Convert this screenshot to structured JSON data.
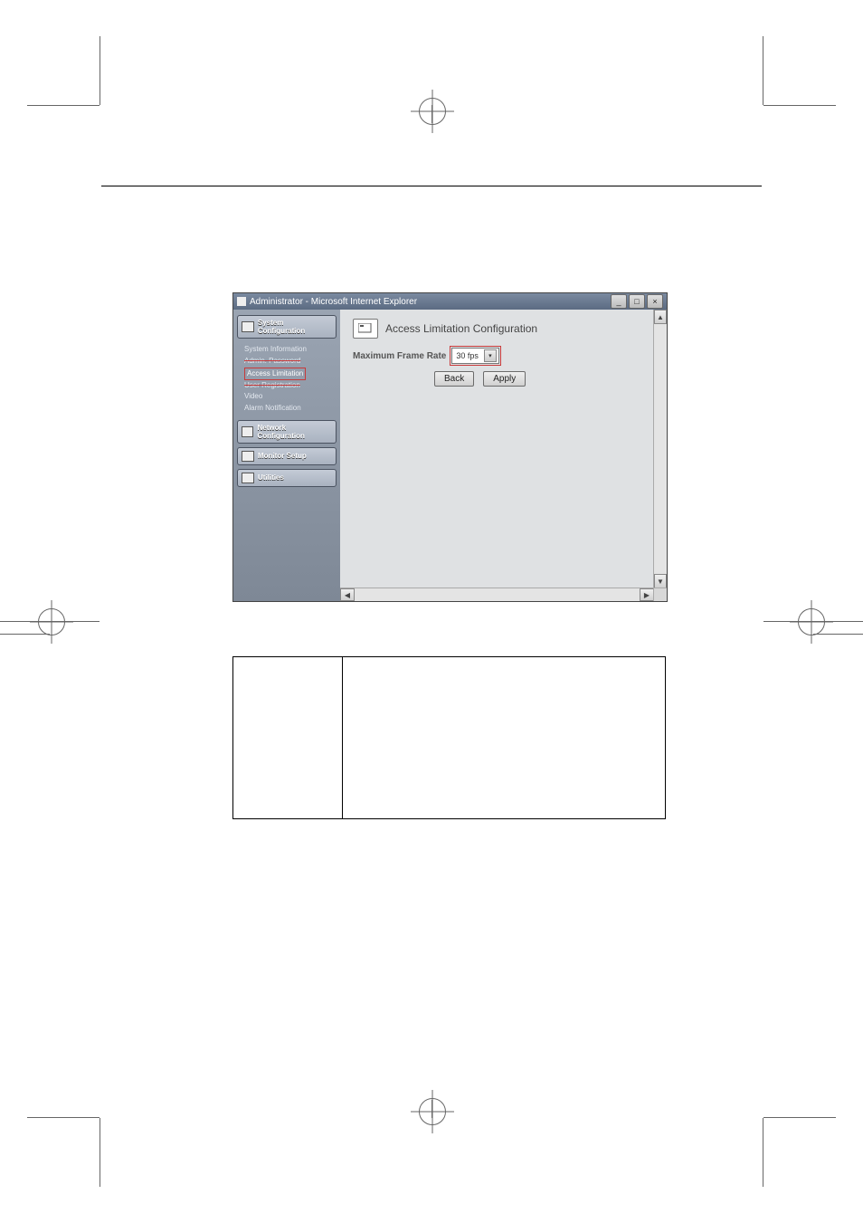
{
  "window": {
    "title": "Administrator - Microsoft Internet Explorer",
    "min_label": "_",
    "max_label": "□",
    "close_label": "×"
  },
  "sidebar": {
    "system_config_label": "System Configuration",
    "items": {
      "sys_info": "System Information",
      "admin_pw": "Admin. Password",
      "access_lim": "Access Limitation",
      "user_reg": "User Registration",
      "video": "Video",
      "alarm": "Alarm Notification"
    },
    "network_config_label": "Network Configuration",
    "monitor_setup_label": "Monitor Setup",
    "utilities_label": "Utilities"
  },
  "content": {
    "heading": "Access Limitation Configuration",
    "frame_rate_label": "Maximum Frame Rate",
    "frame_rate_value": "30 fps",
    "back_label": "Back",
    "apply_label": "Apply"
  },
  "scroll": {
    "up": "▲",
    "down": "▼",
    "left": "◀",
    "right": "▶"
  }
}
